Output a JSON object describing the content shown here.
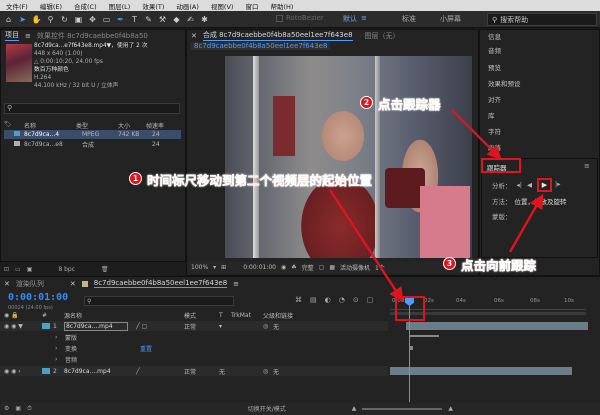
{
  "menu": [
    "文件(F)",
    "编辑(E)",
    "合成(C)",
    "图层(L)",
    "效果(T)",
    "动画(A)",
    "视图(V)",
    "窗口",
    "帮助(H)"
  ],
  "toolbar": {
    "tools": [
      "home-icon",
      "selection-icon",
      "hand-icon",
      "zoom-icon",
      "rotate-icon",
      "camera-icon",
      "pan-behind-icon",
      "rectangle-icon",
      "pen-icon",
      "type-icon",
      "brush-icon",
      "clone-stamp-icon",
      "eraser-icon",
      "roto-brush-icon",
      "puppet-icon"
    ],
    "roto_bezier": "RotoBezier",
    "workspace_default": "默认",
    "workspace_std": "标准",
    "workspace_lib": "小屏幕",
    "search_placeholder": "搜索帮助"
  },
  "project": {
    "tab_project": "项目",
    "tab_effects": "效果控件 8c7d9caebbe0f4b8a50",
    "file_name": "8c7d9ca...e7f643e8.mp4▼，使用了 2 次",
    "dimensions": "448 x 640 (1.00)",
    "duration": "△ 0:00:10:20, 24.00 fps",
    "clip_title": "数百万种颜色",
    "codec": "H.264",
    "audio": "44.100 kHz / 32 bit U / 立体声",
    "columns": [
      "名称",
      "类型",
      "大小",
      "帧速率"
    ],
    "rows": [
      {
        "name": "8c7d9ca...4",
        "type": "MPEG",
        "size": "742 KB",
        "fps": "24",
        "color": "#4aa3c4"
      },
      {
        "name": "8c7d9ca...e8",
        "type": "合成",
        "size": "",
        "fps": "24",
        "color": "#b0b0b0"
      }
    ],
    "bpc": "8 bpc"
  },
  "viewer": {
    "tab_comp": "合成 8c7d9caebbe0f4b8a50eel1ee7f643e8",
    "tab_layer": "图层（无）",
    "breadcrumb": "8c7d9caebbe0f4b8a50eel1ee7f643e8",
    "zoom": "100%",
    "timecode": "0:00:01:00",
    "quality": "完整",
    "camera": "活动摄像机",
    "views": "1个"
  },
  "right_panel": {
    "items": [
      "信息",
      "音频",
      "预览",
      "效果和预设",
      "对齐",
      "库",
      "字符",
      "段落"
    ],
    "tracker_title": "跟踪器",
    "analyze_label": "分析：",
    "method_label": "方法：",
    "method_value": "位置，缩放及旋转",
    "mask_label": "蒙版："
  },
  "timeline": {
    "tab_render": "渲染队列",
    "tab_comp": "8c7d9caebbe0f4b8a50eel1ee7f643e8",
    "timecode": "0:00:01:00",
    "frames": "00024 (24.00 fps)",
    "headers": [
      "#",
      "源名称",
      "模式",
      "T",
      "TrkMat",
      "父级和链接"
    ],
    "layer1": {
      "index": "1",
      "name": "8c7d9ca....mp4",
      "mode": "正常",
      "parent": "无"
    },
    "sublayers": [
      "蒙版",
      "变换",
      "音频"
    ],
    "reset": "重置",
    "layer2": {
      "index": "2",
      "name": "8c7d9ca....mp4",
      "mode": "正常",
      "trkmat": "无",
      "parent": "无"
    },
    "ruler_ticks": [
      "0:00s",
      "02s",
      "04s",
      "06s",
      "08s",
      "10s"
    ],
    "footer_label": "切换开关/模式"
  },
  "annotations": [
    {
      "num": "1",
      "text": "时间标尺移动到第二个视频层的起始位置"
    },
    {
      "num": "2",
      "text": "点击跟踪器"
    },
    {
      "num": "3",
      "text": "点击向前跟踪"
    }
  ],
  "colors": {
    "accent": "#4a9eff",
    "annotation": "#e0141e"
  }
}
